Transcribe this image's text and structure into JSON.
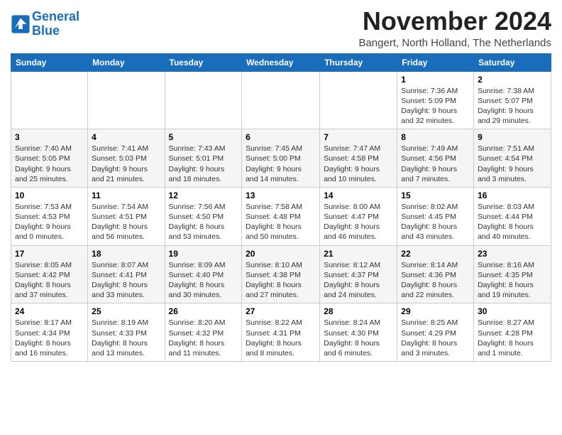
{
  "logo": {
    "line1": "General",
    "line2": "Blue"
  },
  "title": "November 2024",
  "location": "Bangert, North Holland, The Netherlands",
  "weekdays": [
    "Sunday",
    "Monday",
    "Tuesday",
    "Wednesday",
    "Thursday",
    "Friday",
    "Saturday"
  ],
  "weeks": [
    [
      {
        "day": "",
        "info": ""
      },
      {
        "day": "",
        "info": ""
      },
      {
        "day": "",
        "info": ""
      },
      {
        "day": "",
        "info": ""
      },
      {
        "day": "",
        "info": ""
      },
      {
        "day": "1",
        "info": "Sunrise: 7:36 AM\nSunset: 5:09 PM\nDaylight: 9 hours and 32 minutes."
      },
      {
        "day": "2",
        "info": "Sunrise: 7:38 AM\nSunset: 5:07 PM\nDaylight: 9 hours and 29 minutes."
      }
    ],
    [
      {
        "day": "3",
        "info": "Sunrise: 7:40 AM\nSunset: 5:05 PM\nDaylight: 9 hours and 25 minutes."
      },
      {
        "day": "4",
        "info": "Sunrise: 7:41 AM\nSunset: 5:03 PM\nDaylight: 9 hours and 21 minutes."
      },
      {
        "day": "5",
        "info": "Sunrise: 7:43 AM\nSunset: 5:01 PM\nDaylight: 9 hours and 18 minutes."
      },
      {
        "day": "6",
        "info": "Sunrise: 7:45 AM\nSunset: 5:00 PM\nDaylight: 9 hours and 14 minutes."
      },
      {
        "day": "7",
        "info": "Sunrise: 7:47 AM\nSunset: 4:58 PM\nDaylight: 9 hours and 10 minutes."
      },
      {
        "day": "8",
        "info": "Sunrise: 7:49 AM\nSunset: 4:56 PM\nDaylight: 9 hours and 7 minutes."
      },
      {
        "day": "9",
        "info": "Sunrise: 7:51 AM\nSunset: 4:54 PM\nDaylight: 9 hours and 3 minutes."
      }
    ],
    [
      {
        "day": "10",
        "info": "Sunrise: 7:53 AM\nSunset: 4:53 PM\nDaylight: 9 hours and 0 minutes."
      },
      {
        "day": "11",
        "info": "Sunrise: 7:54 AM\nSunset: 4:51 PM\nDaylight: 8 hours and 56 minutes."
      },
      {
        "day": "12",
        "info": "Sunrise: 7:56 AM\nSunset: 4:50 PM\nDaylight: 8 hours and 53 minutes."
      },
      {
        "day": "13",
        "info": "Sunrise: 7:58 AM\nSunset: 4:48 PM\nDaylight: 8 hours and 50 minutes."
      },
      {
        "day": "14",
        "info": "Sunrise: 8:00 AM\nSunset: 4:47 PM\nDaylight: 8 hours and 46 minutes."
      },
      {
        "day": "15",
        "info": "Sunrise: 8:02 AM\nSunset: 4:45 PM\nDaylight: 8 hours and 43 minutes."
      },
      {
        "day": "16",
        "info": "Sunrise: 8:03 AM\nSunset: 4:44 PM\nDaylight: 8 hours and 40 minutes."
      }
    ],
    [
      {
        "day": "17",
        "info": "Sunrise: 8:05 AM\nSunset: 4:42 PM\nDaylight: 8 hours and 37 minutes."
      },
      {
        "day": "18",
        "info": "Sunrise: 8:07 AM\nSunset: 4:41 PM\nDaylight: 8 hours and 33 minutes."
      },
      {
        "day": "19",
        "info": "Sunrise: 8:09 AM\nSunset: 4:40 PM\nDaylight: 8 hours and 30 minutes."
      },
      {
        "day": "20",
        "info": "Sunrise: 8:10 AM\nSunset: 4:38 PM\nDaylight: 8 hours and 27 minutes."
      },
      {
        "day": "21",
        "info": "Sunrise: 8:12 AM\nSunset: 4:37 PM\nDaylight: 8 hours and 24 minutes."
      },
      {
        "day": "22",
        "info": "Sunrise: 8:14 AM\nSunset: 4:36 PM\nDaylight: 8 hours and 22 minutes."
      },
      {
        "day": "23",
        "info": "Sunrise: 8:16 AM\nSunset: 4:35 PM\nDaylight: 8 hours and 19 minutes."
      }
    ],
    [
      {
        "day": "24",
        "info": "Sunrise: 8:17 AM\nSunset: 4:34 PM\nDaylight: 8 hours and 16 minutes."
      },
      {
        "day": "25",
        "info": "Sunrise: 8:19 AM\nSunset: 4:33 PM\nDaylight: 8 hours and 13 minutes."
      },
      {
        "day": "26",
        "info": "Sunrise: 8:20 AM\nSunset: 4:32 PM\nDaylight: 8 hours and 11 minutes."
      },
      {
        "day": "27",
        "info": "Sunrise: 8:22 AM\nSunset: 4:31 PM\nDaylight: 8 hours and 8 minutes."
      },
      {
        "day": "28",
        "info": "Sunrise: 8:24 AM\nSunset: 4:30 PM\nDaylight: 8 hours and 6 minutes."
      },
      {
        "day": "29",
        "info": "Sunrise: 8:25 AM\nSunset: 4:29 PM\nDaylight: 8 hours and 3 minutes."
      },
      {
        "day": "30",
        "info": "Sunrise: 8:27 AM\nSunset: 4:28 PM\nDaylight: 8 hours and 1 minute."
      }
    ]
  ]
}
